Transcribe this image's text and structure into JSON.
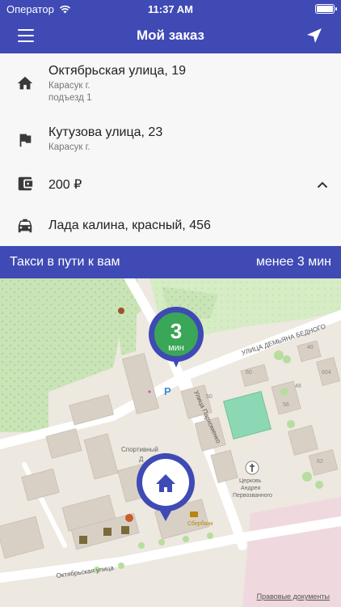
{
  "status": {
    "carrier": "Оператор",
    "time": "11:37 AM"
  },
  "header": {
    "title": "Мой заказ"
  },
  "order": {
    "pickup": {
      "street": "Октябрьская улица, 19",
      "city": "Карасук г.",
      "entrance": "подъезд 1"
    },
    "destination": {
      "street": "Кутузова улица, 23",
      "city": "Карасук г."
    },
    "price": "200 ₽",
    "car": "Лада калина, красный, 456"
  },
  "banner": {
    "status": "Такси в пути к вам",
    "eta": "менее 3 мин"
  },
  "map": {
    "taxi_marker": {
      "number": "3",
      "unit": "мин"
    },
    "streets": {
      "demyana": "УЛИЦА ДЕМЬЯНА БЕДНОГО",
      "parkhomenko": "Улица Пархоменко",
      "oktyabrskaya": "Октябрьская улица"
    },
    "labels": {
      "parking": "P",
      "sport": "Спортивный",
      "sport2": "Д",
      "church1": "Церковь",
      "church2": "Андрея",
      "church3": "Первозванного",
      "bank": "Сбербанк",
      "b40": "40",
      "b48": "48",
      "b60": "60",
      "b50": "50",
      "b56": "56",
      "b604": "604",
      "b62": "62"
    },
    "legal": "Правовые документы"
  },
  "colors": {
    "primary": "#3f4ab5",
    "taxi_green": "#3aa657"
  }
}
